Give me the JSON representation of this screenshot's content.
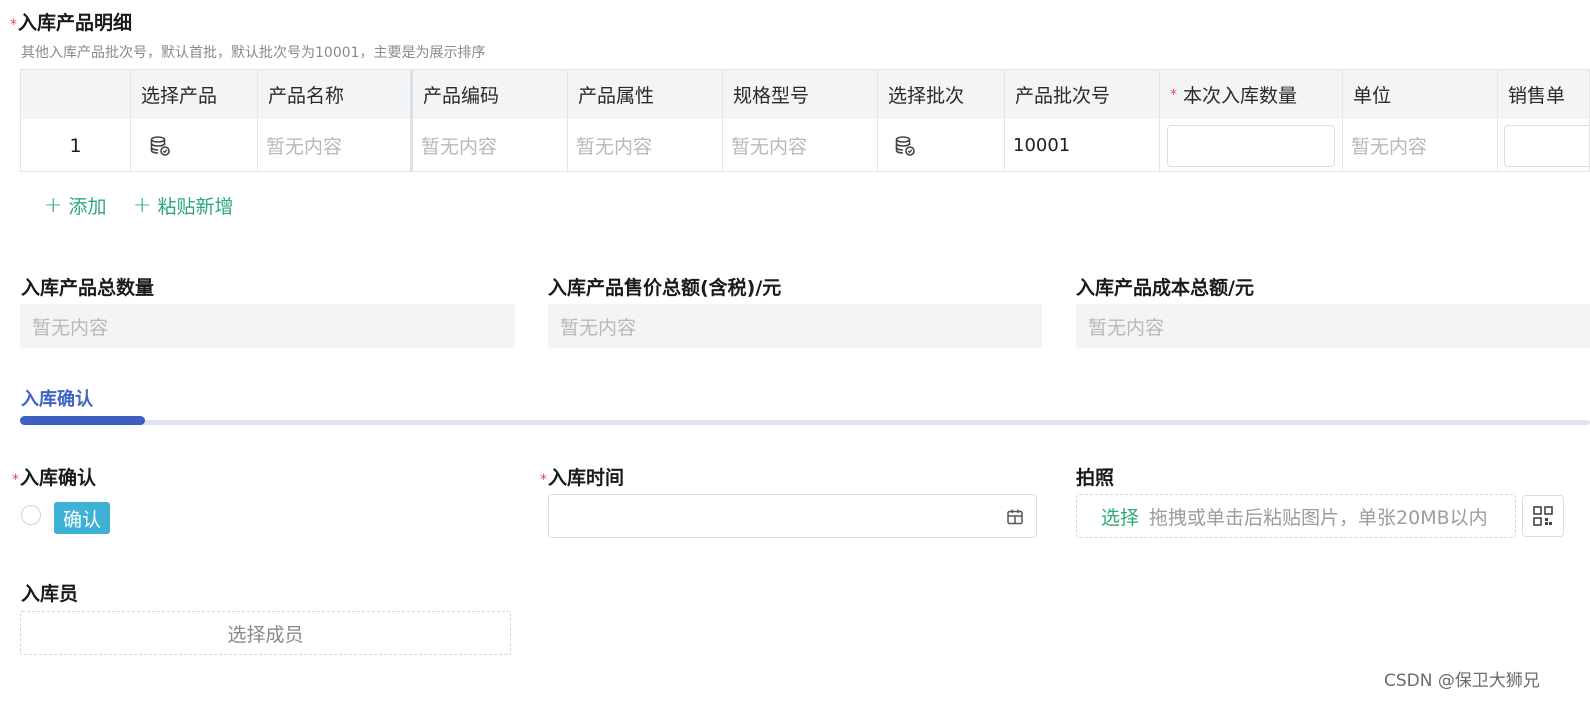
{
  "section": {
    "required_mark": "*",
    "title": "入库产品明细",
    "hint": "其他入库产品批次号，默认首批，默认批次号为10001，主要是为展示排序"
  },
  "table": {
    "columns": [
      "",
      "选择产品",
      "产品名称",
      "产品编码",
      "产品属性",
      "规格型号",
      "选择批次",
      "产品批次号",
      "本次入库数量",
      "单位",
      "销售单"
    ],
    "required_column_mark": "*",
    "rows": [
      {
        "index": "1",
        "name": "暂无内容",
        "code": "暂无内容",
        "attr": "暂无内容",
        "spec": "暂无内容",
        "batch_no": "10001",
        "quantity": "",
        "unit": "暂无内容",
        "sale_unit": ""
      }
    ],
    "select_product_icon": "database-icon",
    "select_batch_icon": "database-icon"
  },
  "actions": {
    "add": "添加",
    "paste_add": "粘贴新增"
  },
  "totals": {
    "total_quantity": {
      "label": "入库产品总数量",
      "value": "暂无内容"
    },
    "total_sale": {
      "label": "入库产品售价总额(含税)/元",
      "value": "暂无内容"
    },
    "total_cost": {
      "label": "入库产品成本总额/元",
      "value": "暂无内容"
    }
  },
  "tab": {
    "label": "入库确认"
  },
  "confirm": {
    "required_mark": "*",
    "label": "入库确认",
    "tag": "确认"
  },
  "time": {
    "required_mark": "*",
    "label": "入库时间",
    "value": "",
    "icon": "calendar-icon"
  },
  "photo": {
    "label": "拍照",
    "select": "选择",
    "hint": "拖拽或单击后粘贴图片，单张20MB以内",
    "icon": "qrcode-icon"
  },
  "operator": {
    "label": "入库员",
    "button": "选择成员"
  },
  "watermark": "CSDN @保卫大狮兄",
  "colors": {
    "accent_green": "#2fa877",
    "tab_blue": "#3e5fc2",
    "confirm_tag": "#3fb1d4",
    "required_red": "#e5484d"
  }
}
